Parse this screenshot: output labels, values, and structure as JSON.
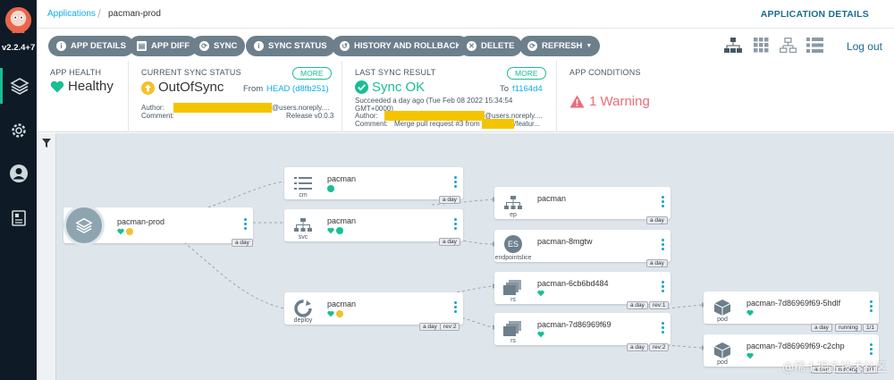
{
  "sidebar": {
    "version": "v2.2.4+7",
    "items": [
      {
        "icon": "layers-icon",
        "active": true
      },
      {
        "icon": "gear-icon",
        "active": false
      },
      {
        "icon": "user-icon",
        "active": false
      },
      {
        "icon": "docs-icon",
        "active": false
      }
    ]
  },
  "breadcrumb": {
    "root": "Applications",
    "current": "pacman-prod"
  },
  "header": {
    "title": "APPLICATION DETAILS",
    "logout": "Log out"
  },
  "toolbar": {
    "app_details": "APP DETAILS",
    "app_diff": "APP DIFF",
    "sync": "SYNC",
    "sync_status": "SYNC STATUS",
    "history": "HISTORY AND ROLLBACK",
    "delete": "DELETE",
    "refresh": "REFRESH"
  },
  "app_health": {
    "title": "APP HEALTH",
    "value": "Healthy"
  },
  "sync_status": {
    "title": "CURRENT SYNC STATUS",
    "more": "MORE",
    "value": "OutOfSync",
    "from_label": "From",
    "from_ref": "HEAD (d8fb251)",
    "author_label": "Author:",
    "author_suffix": "@users.noreply....",
    "comment_label": "Comment:",
    "comment": "Release v0.0.3"
  },
  "last_sync": {
    "title": "LAST SYNC RESULT",
    "more": "MORE",
    "value": "Sync OK",
    "to_label": "To",
    "to_ref": "f1164d4",
    "time_line1": "Succeeded a day ago (Tue Feb 08 2022 15:34:54",
    "time_line2": "GMT+0000)",
    "author_label": "Author:",
    "author_suffix": "@users.noreply....",
    "comment_label": "Comment:",
    "comment_prefix": "Merge pull request #3 from",
    "comment_suffix": "/featur..."
  },
  "conditions": {
    "title": "APP CONDITIONS",
    "value": "1 Warning"
  },
  "nodes": {
    "root": {
      "name": "pacman-prod",
      "age": "a day"
    },
    "cm": {
      "name": "pacman",
      "kind": "cm",
      "age": "a day"
    },
    "svc": {
      "name": "pacman",
      "kind": "svc",
      "age": "a day"
    },
    "deploy": {
      "name": "pacman",
      "kind": "deploy",
      "age": "a day",
      "rev": "rev:2"
    },
    "ep": {
      "name": "pacman",
      "kind": "ep",
      "age": "a day"
    },
    "es": {
      "name": "pacman-8mgtw",
      "kind": "endpointslice",
      "age": "a day",
      "badge": "ES"
    },
    "rs1": {
      "name": "pacman-6cb6bd484",
      "kind": "rs",
      "age": "a day",
      "rev": "rev:1"
    },
    "rs2": {
      "name": "pacman-7d86969f69",
      "kind": "rs",
      "age": "a day",
      "rev": "rev:2"
    },
    "pod1": {
      "name": "pacman-7d86969f69-5hdlf",
      "kind": "pod",
      "age": "a day",
      "state": "running",
      "ready": "1/1"
    },
    "pod2": {
      "name": "pacman-7d86969f69-c2chp",
      "kind": "pod",
      "age": "a day",
      "state": "running",
      "ready": "1/1"
    }
  },
  "watermark": "@稀土掘金技术社区",
  "colors": {
    "accent": "#18be94",
    "link": "#0dadea",
    "warning": "#e96d76",
    "sync_yellow": "#f4c030",
    "button": "#6d7f8b"
  }
}
